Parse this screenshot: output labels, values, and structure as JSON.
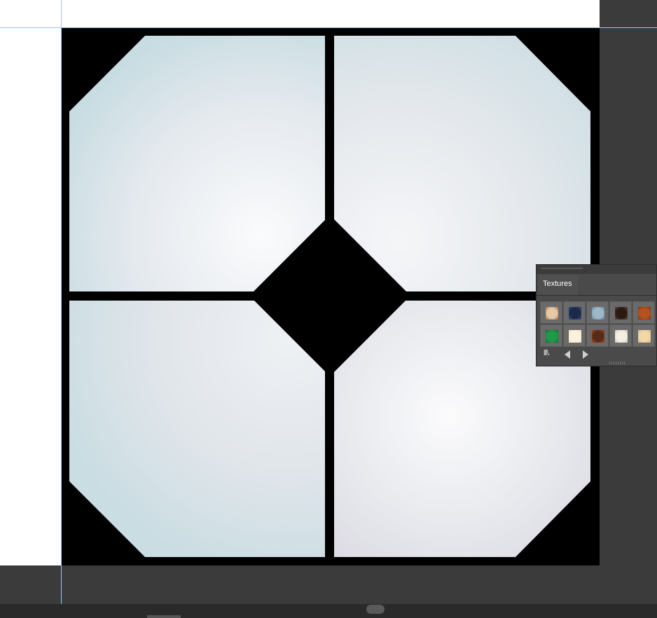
{
  "document": {
    "artwork": "window-pane-tile"
  },
  "textures_panel": {
    "tab_label": "Textures",
    "swatches": [
      {
        "name": "texture-swatch-1",
        "color": "#e7c7a4",
        "accent": "#8a6a4f"
      },
      {
        "name": "texture-swatch-2",
        "color": "#1c2a4a",
        "accent": "#3c5a8a"
      },
      {
        "name": "texture-swatch-3",
        "color": "#9fb8c8",
        "accent": "#5a7a8a"
      },
      {
        "name": "texture-swatch-4",
        "color": "#2a1a16",
        "accent": "#6b4a3a"
      },
      {
        "name": "texture-swatch-5",
        "color": "#b5521e",
        "accent": "#7a3210"
      },
      {
        "name": "texture-swatch-6",
        "color": "#1f9a4a",
        "accent": "#0f6a2f"
      },
      {
        "name": "texture-swatch-7",
        "color": "#fbf1dc",
        "accent": "#efe0c0"
      },
      {
        "name": "texture-swatch-8",
        "color": "#5a2a18",
        "accent": "#a8521f"
      },
      {
        "name": "texture-swatch-9",
        "color": "#f3efe4",
        "accent": "#c9c2b0"
      },
      {
        "name": "texture-swatch-10",
        "color": "#f2d7a8",
        "accent": "#d8b378"
      }
    ],
    "footer": {
      "library_icon": "libraries-icon",
      "prev_icon": "previous-arrow-icon",
      "next_icon": "next-arrow-icon"
    }
  },
  "colors": {
    "guide": "#5fe6f2",
    "pasteboard": "#3b3b3b",
    "frame": "#000000",
    "glass_light": "#f7f8fa",
    "glass_tint": "#c9dde3"
  }
}
